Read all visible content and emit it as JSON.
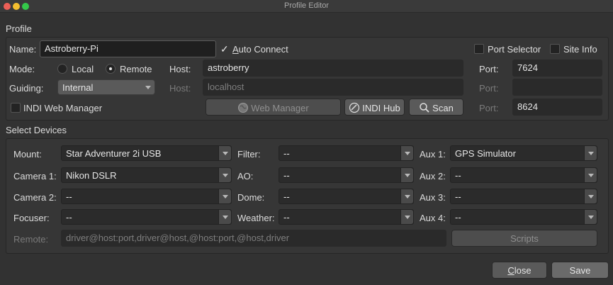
{
  "window": {
    "title": "Profile Editor"
  },
  "profile": {
    "section_label": "Profile",
    "name_label": "Name:",
    "name_value": "Astroberry-Pi",
    "auto_connect_label": "Auto Connect",
    "auto_connect_checked": true,
    "port_selector_label": "Port Selector",
    "site_info_label": "Site Info",
    "mode_label": "Mode:",
    "mode_local": "Local",
    "mode_remote": "Remote",
    "mode_selected": "Remote",
    "host_label": "Host:",
    "host_value": "astroberry",
    "port_label": "Port:",
    "port_value": "7624",
    "guiding_label": "Guiding:",
    "guiding_value": "Internal",
    "guide_host_label": "Host:",
    "guide_host_placeholder": "localhost",
    "guide_port_label": "Port:",
    "indi_web_manager_label": "INDI Web Manager",
    "web_manager_button": "Web Manager",
    "indi_hub_button": "INDI Hub",
    "scan_button": "Scan",
    "web_port_label": "Port:",
    "web_port_value": "8624"
  },
  "devices": {
    "section_label": "Select Devices",
    "mount_label": "Mount:",
    "mount_value": "Star Adventurer 2i USB",
    "camera1_label": "Camera 1:",
    "camera1_value": "Nikon DSLR",
    "camera2_label": "Camera 2:",
    "camera2_value": "--",
    "focuser_label": "Focuser:",
    "focuser_value": "--",
    "filter_label": "Filter:",
    "filter_value": "--",
    "ao_label": "AO:",
    "ao_value": "--",
    "dome_label": "Dome:",
    "dome_value": "--",
    "weather_label": "Weather:",
    "weather_value": "--",
    "aux1_label": "Aux 1:",
    "aux1_value": "GPS Simulator",
    "aux2_label": "Aux 2:",
    "aux2_value": "--",
    "aux3_label": "Aux 3:",
    "aux3_value": "--",
    "aux4_label": "Aux 4:",
    "aux4_value": "--",
    "remote_label": "Remote:",
    "remote_placeholder": "driver@host:port,driver@host,@host:port,@host,driver",
    "scripts_button": "Scripts"
  },
  "footer": {
    "close_button": "Close",
    "save_button": "Save"
  }
}
